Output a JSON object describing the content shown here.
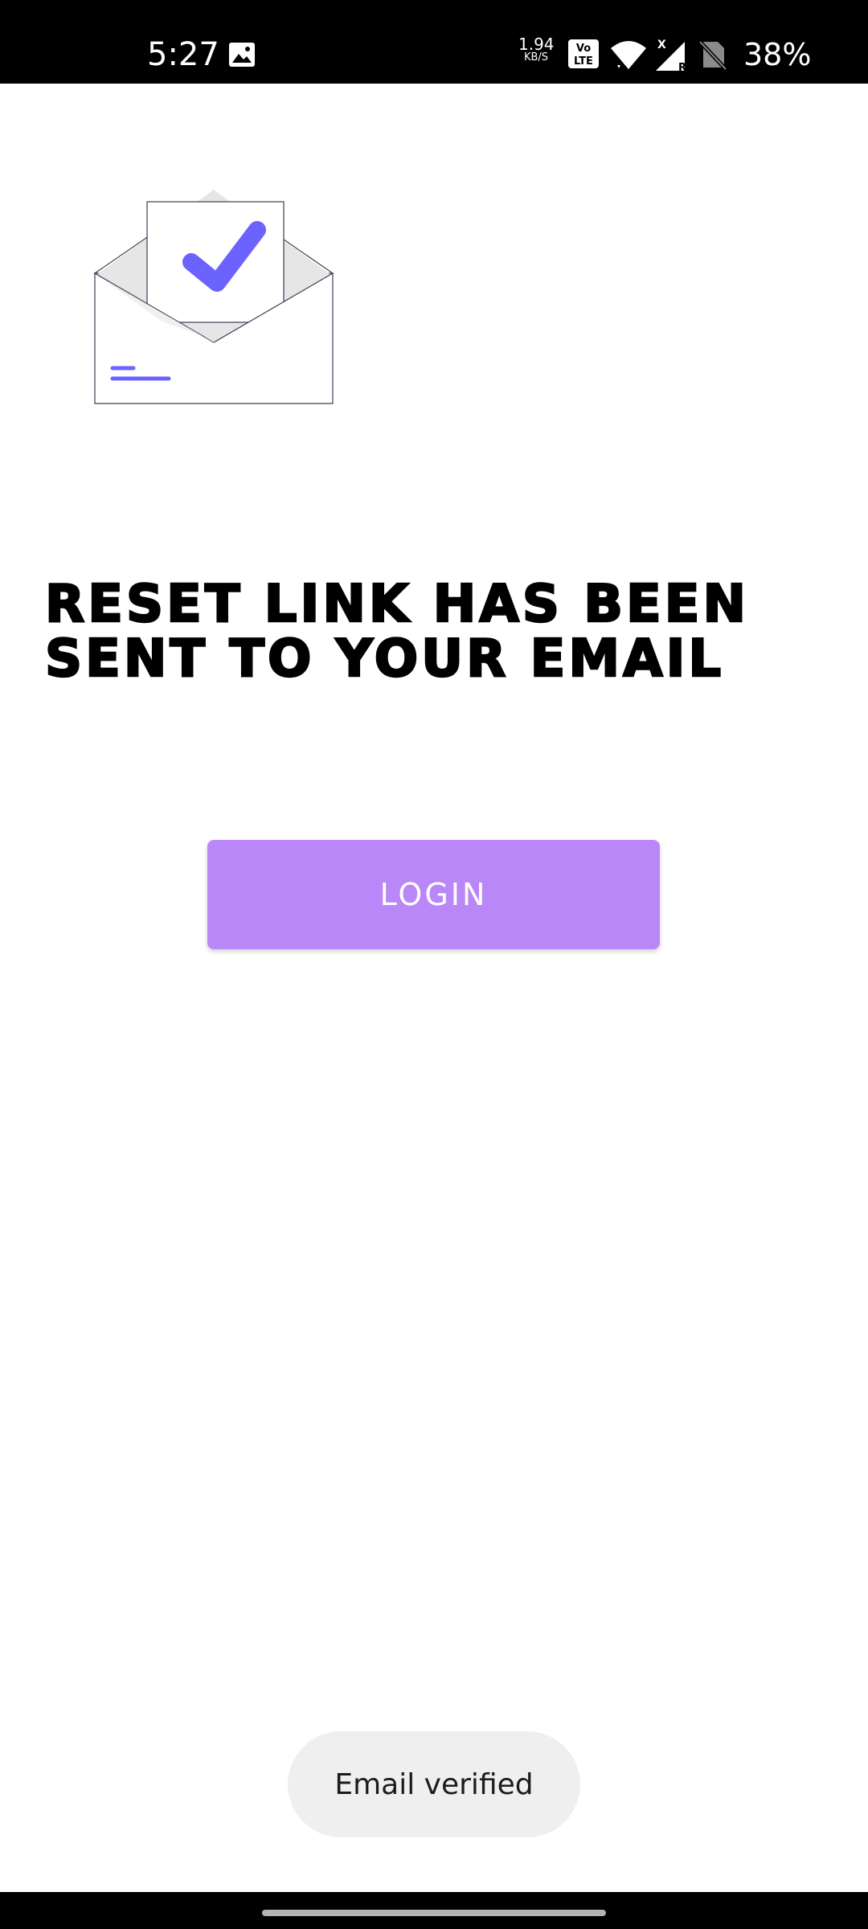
{
  "status_bar": {
    "time": "5:27",
    "speed_value": "1.94",
    "speed_unit": "KB/S",
    "volte_label": "Vo LTE",
    "battery": "38%",
    "icons": [
      "gallery-icon",
      "volte-icon",
      "wifi-icon",
      "signal-icon",
      "no-sim-icon"
    ]
  },
  "main": {
    "illustration": "envelope-check-icon",
    "heading": "RESET LINK HAS BEEN SENT TO YOUR EMAIL",
    "login_label": "LOGIN"
  },
  "toast": {
    "message": "Email verified"
  },
  "colors": {
    "accent": "#b987f7",
    "check": "#6c63ff",
    "toast_bg": "#efefef"
  }
}
